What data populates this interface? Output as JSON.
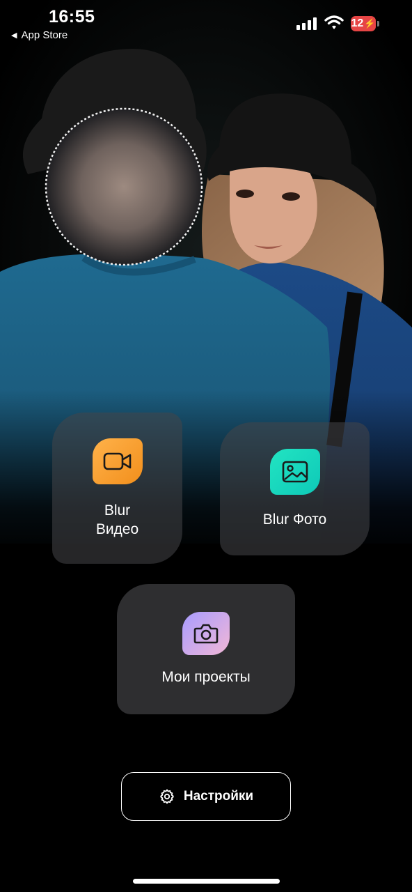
{
  "status_bar": {
    "time": "16:55",
    "back_label": "App Store",
    "battery_level": "12"
  },
  "hero": {
    "image": "couple-bucket-hats-photo",
    "face_blurred": true
  },
  "cards": {
    "blur_video": {
      "label_line1": "Blur",
      "label_line2": "Видео",
      "icon": "video-camera-icon",
      "color": "#f7a733"
    },
    "blur_photo": {
      "label": "Blur Фото",
      "icon": "image-icon",
      "color": "#1ad6bd"
    },
    "my_projects": {
      "label": "Мои проекты",
      "icon": "camera-icon",
      "color": "#c4a8f2"
    }
  },
  "settings": {
    "label": "Настройки",
    "icon": "gear-icon"
  }
}
